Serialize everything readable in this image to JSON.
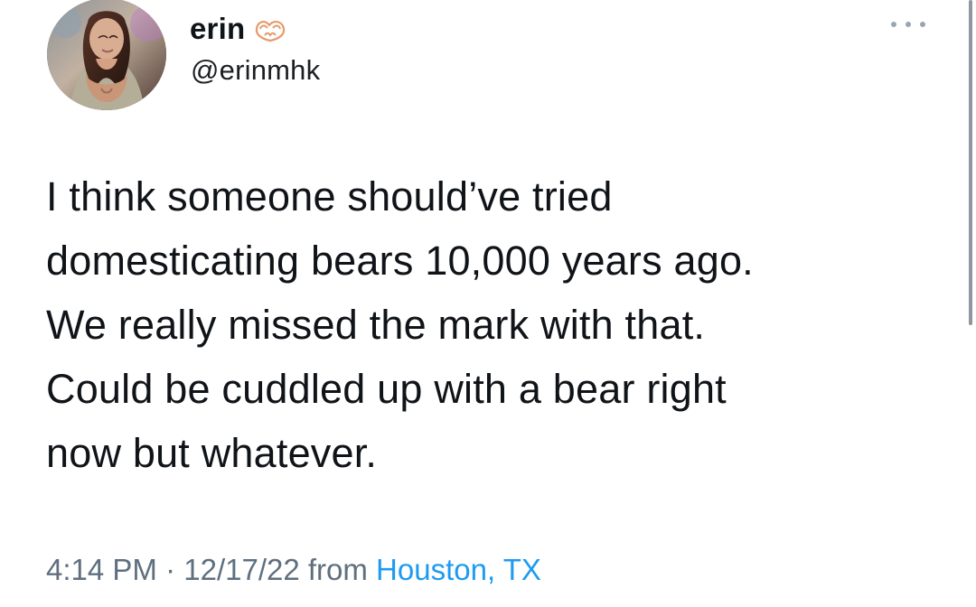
{
  "tweet": {
    "author": {
      "display_name": "erin",
      "handle": "@erinmhk",
      "avatar_icon": "profile-photo",
      "emoji_icon": "heart-hands-icon"
    },
    "text": "I think someone should’ve tried\ndomesticating bears 10,000 years ago.\nWe really missed the mark with that.\nCould be cuddled up with a bear right\nnow but whatever.",
    "meta": {
      "time": "4:14 PM",
      "separator": " · ",
      "date": "12/17/22",
      "from_label": " from ",
      "location": "Houston, TX"
    },
    "actions": {
      "more_icon": "more-options-icon"
    }
  }
}
